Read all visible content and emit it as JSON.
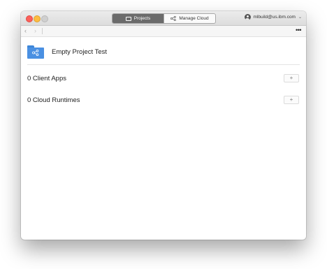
{
  "titlebar": {
    "tabs": [
      {
        "label": "Projects",
        "icon": "folder-outline-icon",
        "active": true
      },
      {
        "label": "Manage Cloud",
        "icon": "network-icon",
        "active": false
      }
    ],
    "user": {
      "email": "mlbuild@us.ibm.com",
      "icon": "user-avatar-icon",
      "chevron": "⌄"
    }
  },
  "toolbar": {
    "back": "‹",
    "forward": "›",
    "more": "•••"
  },
  "project": {
    "title": "Empty Project Test",
    "icon": "project-folder-icon",
    "icon_color": "#4a90e2"
  },
  "sections": [
    {
      "label": "0 Client Apps",
      "add": "+"
    },
    {
      "label": "0 Cloud Runtimes",
      "add": "+"
    }
  ],
  "colors": {
    "close": "#fc605b",
    "minimize": "#fdbc40",
    "zoom_inactive": "#cfcfcf",
    "active_tab": "#6b6b6b"
  }
}
